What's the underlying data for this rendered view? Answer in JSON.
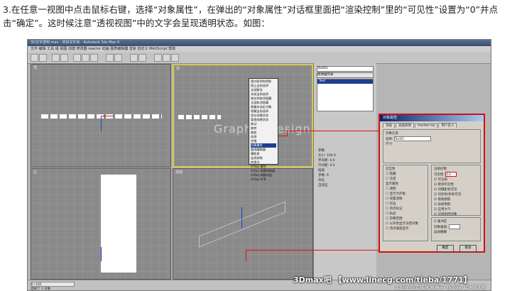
{
  "caption": "3.在任意一视图中点击鼠标右键，选择“对象属性”，在弹出的“对象属性”对话框里面把“渲染控制”里的“可见性”设置为“0”并点击“确定”。这时候注意“透视视图”中的文字会呈现透明状态。如图：",
  "app": {
    "title": "3D文字透明.max - 项目文件夹 - Autodesk 3ds Max 9",
    "menu": "文件  编辑  工具  组  视图  创建  修改器  reactor  动画  图表编辑器  渲染  自定义  MAXScript  帮助",
    "viewports": {
      "top": "顶",
      "front": "前",
      "left": "左",
      "perspective": "透视"
    },
    "frame_counter": "0 / 100",
    "status": "选择了 1 对象"
  },
  "context_menu": {
    "items": [
      "视口照明和阴影",
      "孤立当前选择",
      "全部解冻",
      "冻结当前选择",
      "按名称取消隐藏",
      "全部取消隐藏",
      "隐藏未选定对象",
      "隐藏当前选择",
      "保存场景状态",
      "管理场景状态",
      "移动",
      "旋转",
      "缩放",
      "选择",
      "克隆",
      "对象属性",
      "曲线编辑器",
      "摄影表",
      "连线参数",
      "转换为",
      "V-Ray 属性",
      "V-Ray 场景转换器",
      "V-Ray 网格导出",
      "V-Ray VFB"
    ],
    "highlighted_index": 15
  },
  "command_panel": {
    "object_name": "Text01",
    "modifier_list": "修改器列表",
    "stack_item": "Text",
    "params": [
      "参数",
      "大小: 100.0",
      "字间距: 0.0",
      "行间距: 0.0",
      "插值",
      "步数: 6",
      "优化",
      "自适应"
    ]
  },
  "dialog": {
    "title": "对象属性",
    "tabs": [
      "常规",
      "高级照明",
      "mental ray",
      "用户定义"
    ],
    "object_info_title": "对象信息",
    "name_label": "名称:",
    "name_value": "Text01",
    "dimensions_label": "尺寸:",
    "interaction_title": "交互性",
    "hide_label": "隐藏",
    "freeze_label": "冻结",
    "display_props_title": "显示属性",
    "display_props": [
      "透明",
      "显示为外框",
      "背面消隐",
      "仅边",
      "顶点标记",
      "轨迹",
      "忽略范围",
      "以灰色显示冻结对象",
      "顶点通道显示"
    ],
    "render_control_title": "渲染控制",
    "visibility_label": "可见性:",
    "visibility_value": "0.0",
    "render_options": [
      "可渲染",
      "继承可见性",
      "对摄影机可见",
      "对反射/折射可见",
      "接收阴影",
      "投射阴影",
      "应用大气",
      "渲染阻挡对象"
    ],
    "gbuffer_title": "G 缓冲区",
    "object_channel_label": "对象通道:",
    "motion_blur_title": "运动模糊",
    "ok_label": "确定",
    "cancel_label": "取消"
  },
  "watermark_text": "Graphic Design",
  "footer_watermark": "3Dmax吧 【www.linecg.com/tieba/1771】",
  "footer_sub": "本贴子图文独家发表于 线条网 3DMAX吧"
}
